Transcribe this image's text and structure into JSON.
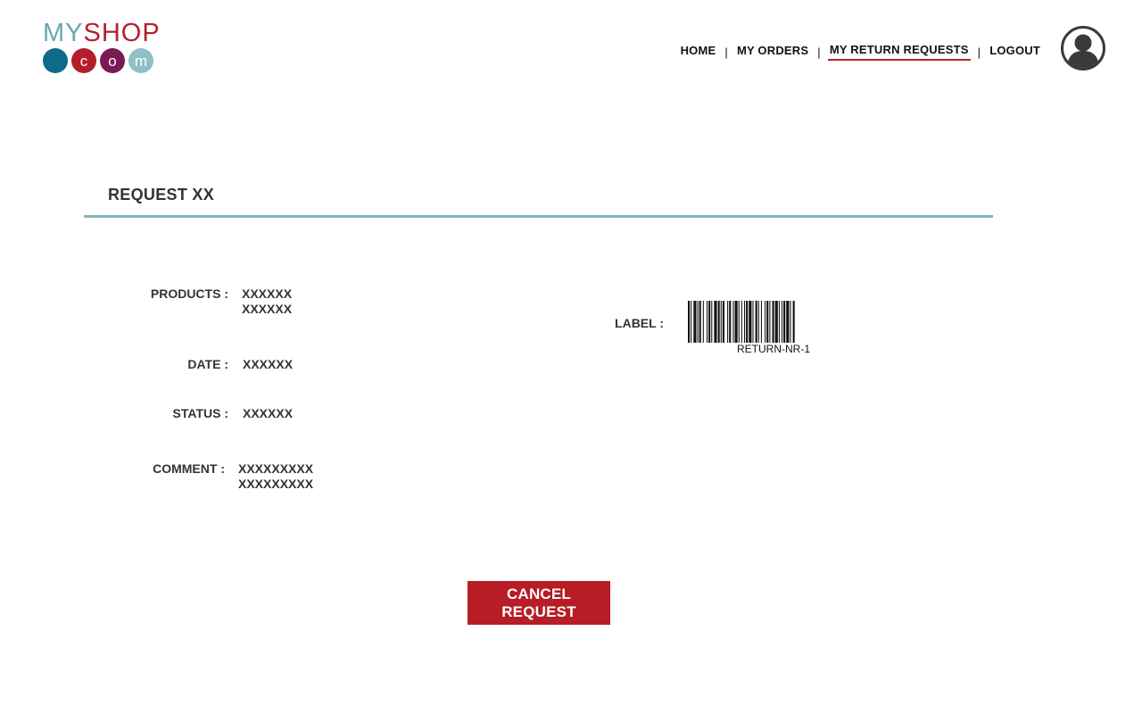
{
  "brand": {
    "logo_my": "MY",
    "logo_shop": "SHOP",
    "logo_dots": [
      "",
      "c",
      "o",
      "m"
    ]
  },
  "nav": {
    "items": [
      {
        "label": "HOME",
        "active": false
      },
      {
        "label": "MY ORDERS",
        "active": false
      },
      {
        "label": "MY RETURN REQUESTS",
        "active": true
      },
      {
        "label": "LOGOUT",
        "active": false
      }
    ],
    "separator": "|"
  },
  "request": {
    "title": "REQUEST XX",
    "products_label": "PRODUCTS :",
    "products": [
      "XXXXXX",
      "XXXXXX"
    ],
    "date_label": "DATE :",
    "date": "XXXXXX",
    "status_label": "STATUS :",
    "status": "XXXXXX",
    "comment_label": "COMMENT :",
    "comment": [
      "XXXXXXXXX",
      "XXXXXXXXX"
    ],
    "label_label": "LABEL :",
    "barcode_text": "RETURN-NR-1"
  },
  "actions": {
    "cancel_label": "CANCEL REQUEST"
  },
  "colors": {
    "brand_red": "#b8202b",
    "brand_teal": "#6aa6b5",
    "rule": "#7fb6b6",
    "button": "#b81c24"
  },
  "icons": {
    "avatar": "user-avatar-icon"
  }
}
